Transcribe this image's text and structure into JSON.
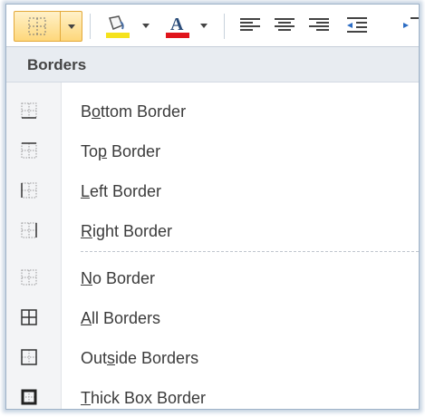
{
  "toolbar": {
    "buttons": [
      "borders-split-button",
      "fill-color-button",
      "font-color-button",
      "align-left",
      "align-center",
      "align-right",
      "decrease-indent"
    ],
    "colors": {
      "highlight": "#f5e21c",
      "font": "#e0141b",
      "accent": "#e3a93a"
    }
  },
  "menu": {
    "header": "Borders",
    "items": [
      {
        "pre": "B",
        "ul": "o",
        "post": "ttom Border",
        "icon": "bottom-border-icon"
      },
      {
        "pre": "To",
        "ul": "p",
        "post": " Border",
        "icon": "top-border-icon"
      },
      {
        "pre": "",
        "ul": "L",
        "post": "eft Border",
        "icon": "left-border-icon"
      },
      {
        "pre": "",
        "ul": "R",
        "post": "ight Border",
        "icon": "right-border-icon"
      },
      {
        "pre": "",
        "ul": "N",
        "post": "o Border",
        "icon": "no-border-icon"
      },
      {
        "pre": "",
        "ul": "A",
        "post": "ll Borders",
        "icon": "all-borders-icon"
      },
      {
        "pre": "Out",
        "ul": "s",
        "post": "ide Borders",
        "icon": "outside-borders-icon"
      },
      {
        "pre": "",
        "ul": "T",
        "post": "hick Box Border",
        "icon": "thick-box-border-icon"
      }
    ]
  }
}
